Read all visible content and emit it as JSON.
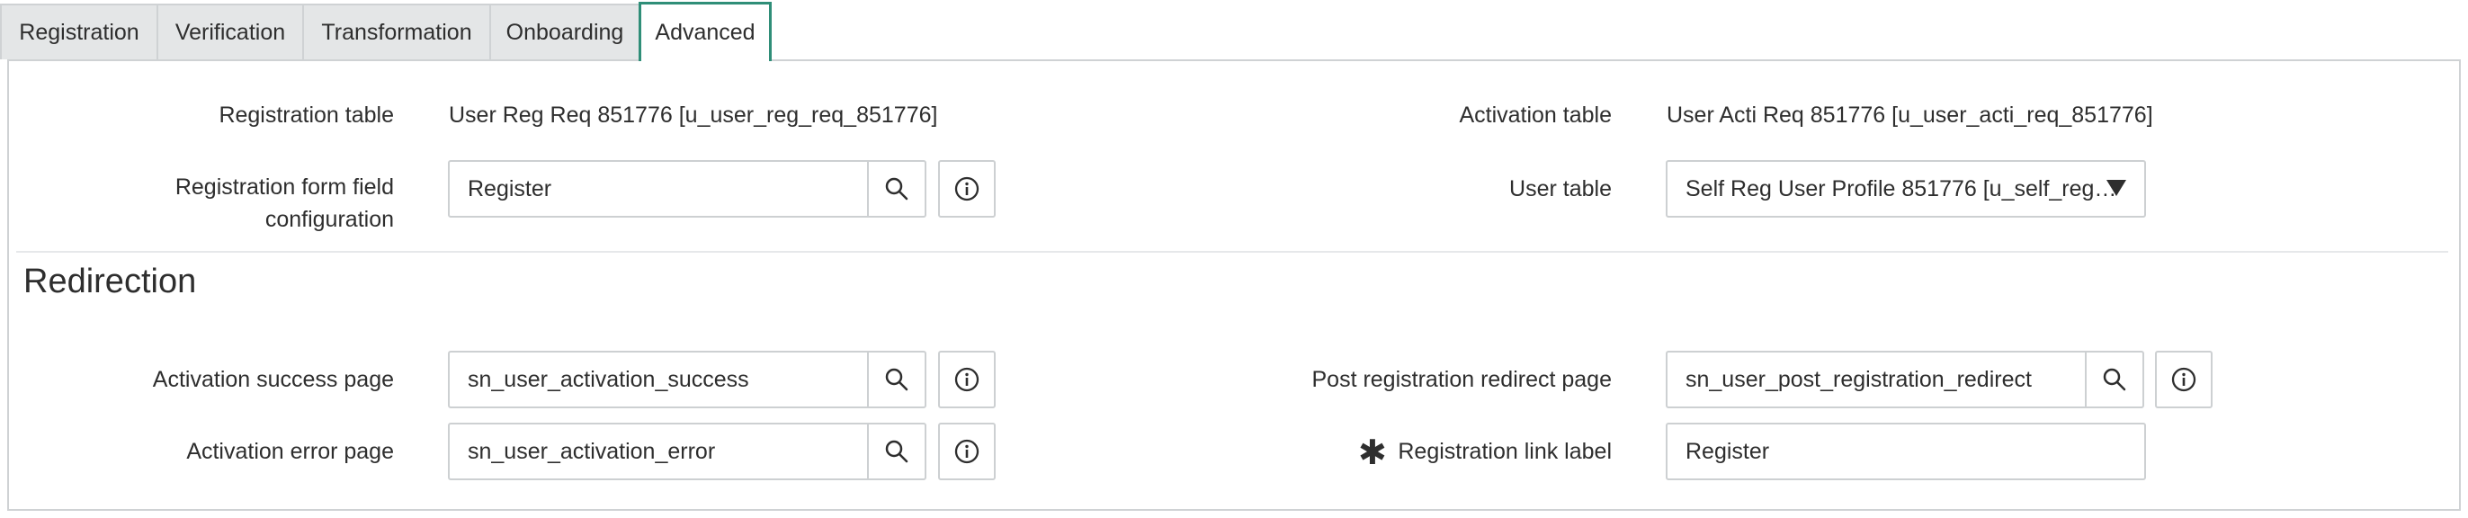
{
  "tabs": [
    {
      "label": "Registration"
    },
    {
      "label": "Verification"
    },
    {
      "label": "Transformation"
    },
    {
      "label": "Onboarding"
    },
    {
      "label": "Advanced"
    }
  ],
  "form": {
    "registration_table": {
      "label": "Registration table",
      "value": "User Reg Req 851776 [u_user_reg_req_851776]"
    },
    "activation_table": {
      "label": "Activation table",
      "value": "User Acti Req 851776 [u_user_acti_req_851776]"
    },
    "reg_form_config": {
      "label_line1": "Registration form field",
      "label_line2": "configuration",
      "value": "Register"
    },
    "user_table": {
      "label": "User table",
      "value": "Self Reg User Profile 851776 [u_self_reg…"
    }
  },
  "redirection": {
    "title": "Redirection",
    "activation_success": {
      "label": "Activation success page",
      "value": "sn_user_activation_success"
    },
    "post_registration": {
      "label": "Post registration redirect page",
      "value": "sn_user_post_registration_redirect"
    },
    "activation_error": {
      "label": "Activation error page",
      "value": "sn_user_activation_error"
    },
    "registration_link": {
      "label": "Registration link label",
      "value": "Register",
      "required_mark": "✱"
    }
  },
  "icons": {
    "search": "search-icon",
    "info": "info-icon",
    "dropdown": "caret-down-icon"
  },
  "colors": {
    "active_tab_border": "#2f8e78",
    "border": "#cdd0d2",
    "tab_bg": "#e4e6e7"
  }
}
